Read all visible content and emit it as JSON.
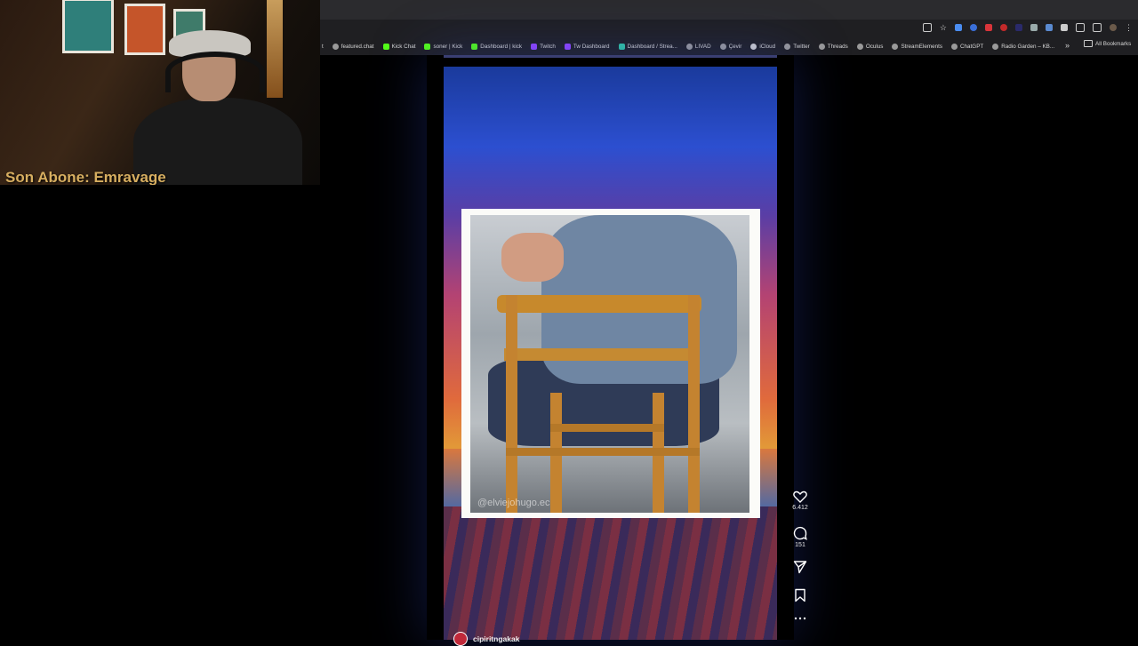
{
  "webcam": {
    "overlay_text": "Son Abone: Emravage"
  },
  "browser": {
    "bookmarks_partial_left": "t",
    "bookmarks": [
      {
        "label": "featured.chat",
        "icon": "globe-icon",
        "color": "#9a9a9a"
      },
      {
        "label": "Kick Chat",
        "icon": "kick-icon",
        "color": "#53fc18"
      },
      {
        "label": "soner | Kick",
        "icon": "kick-icon",
        "color": "#53fc18"
      },
      {
        "label": "Dashboard | kick",
        "icon": "kick-icon",
        "color": "#53fc18"
      },
      {
        "label": "Twitch",
        "icon": "twitch-icon",
        "color": "#9146ff"
      },
      {
        "label": "Tw Dashboard",
        "icon": "twitch-icon",
        "color": "#9146ff"
      },
      {
        "label": "Dashboard / Strea...",
        "icon": "streamlabs-icon",
        "color": "#31c3a2"
      },
      {
        "label": "LIVAD",
        "icon": "globe-icon",
        "color": "#9a9a9a"
      },
      {
        "label": "Çevir",
        "icon": "globe-icon",
        "color": "#9a9a9a"
      },
      {
        "label": "iCloud",
        "icon": "apple-icon",
        "color": "#cfcfcf"
      },
      {
        "label": "Twitter",
        "icon": "globe-icon",
        "color": "#9a9a9a"
      },
      {
        "label": "Threads",
        "icon": "globe-icon",
        "color": "#9a9a9a"
      },
      {
        "label": "Oculus",
        "icon": "globe-icon",
        "color": "#9a9a9a"
      },
      {
        "label": "StreamElements",
        "icon": "globe-icon",
        "color": "#9a9a9a"
      },
      {
        "label": "ChatGPT",
        "icon": "globe-icon",
        "color": "#9a9a9a"
      },
      {
        "label": "Radio Garden – KB...",
        "icon": "globe-icon",
        "color": "#9a9a9a"
      }
    ],
    "all_bookmarks": "All Bookmarks"
  },
  "reel": {
    "watermark": "@elviejohugo.ec",
    "username": "cipiritngakak",
    "likes": "6.412",
    "comments": "151"
  }
}
